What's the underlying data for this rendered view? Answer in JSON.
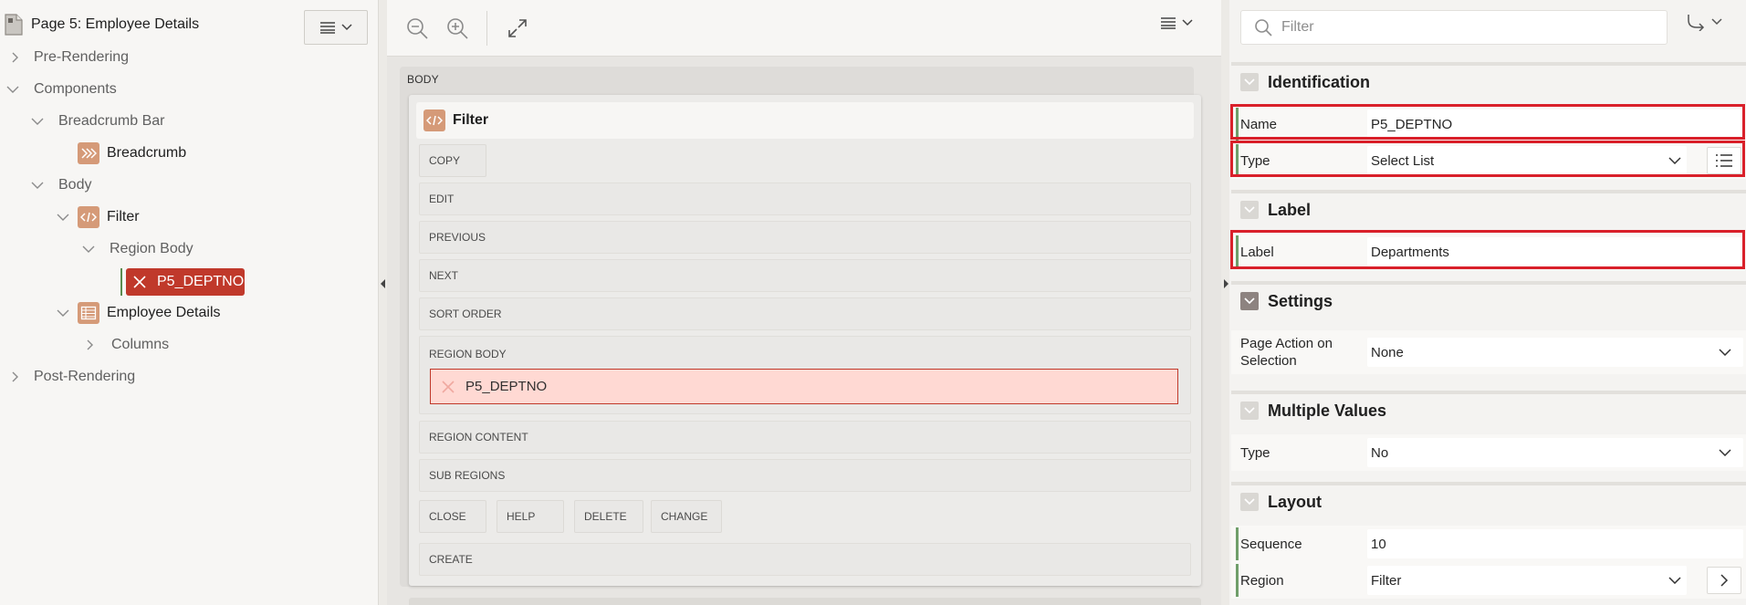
{
  "left_panel": {
    "title": "Page 5: Employee Details",
    "tree": {
      "pre_rendering": "Pre-Rendering",
      "components": "Components",
      "breadcrumb_bar": "Breadcrumb Bar",
      "breadcrumb": "Breadcrumb",
      "body": "Body",
      "filter": "Filter",
      "region_body": "Region Body",
      "selected_item": "P5_DEPTNO",
      "employee_details": "Employee Details",
      "columns": "Columns",
      "post_rendering": "Post-Rendering"
    }
  },
  "center": {
    "body_label": "BODY",
    "region_title": "Filter",
    "slots": {
      "copy": "COPY",
      "edit": "EDIT",
      "previous": "PREVIOUS",
      "next": "NEXT",
      "sort_order": "SORT ORDER",
      "region_body": "REGION BODY",
      "region_body_item": "P5_DEPTNO",
      "region_content": "REGION CONTENT",
      "sub_regions": "SUB REGIONS",
      "close": "CLOSE",
      "help": "HELP",
      "delete": "DELETE",
      "change": "CHANGE",
      "create": "CREATE"
    }
  },
  "right_panel": {
    "search_placeholder": "Filter",
    "identification": {
      "title": "Identification",
      "name_label": "Name",
      "name_value": "P5_DEPTNO",
      "type_label": "Type",
      "type_value": "Select List"
    },
    "label_section": {
      "title": "Label",
      "label_label": "Label",
      "label_value": "Departments"
    },
    "settings": {
      "title": "Settings",
      "page_action_label": "Page Action on Selection",
      "page_action_value": "None"
    },
    "multiple_values": {
      "title": "Multiple Values",
      "type_label": "Type",
      "type_value": "No"
    },
    "layout": {
      "title": "Layout",
      "sequence_label": "Sequence",
      "sequence_value": "10",
      "region_label": "Region",
      "region_value": "Filter"
    }
  },
  "icons": {
    "page": "page-icon",
    "menu": "hamburger-menu-icon",
    "zoom_out": "zoom-out-icon",
    "zoom_in": "zoom-in-icon",
    "expand": "expand-icon",
    "search": "search-icon",
    "go_to": "go-to-group-icon"
  },
  "colors": {
    "selected_node": "#c0392b",
    "highlight_border": "#d9202a",
    "component_icon": "#d59a78",
    "modified_marker": "#6f9e6a"
  }
}
